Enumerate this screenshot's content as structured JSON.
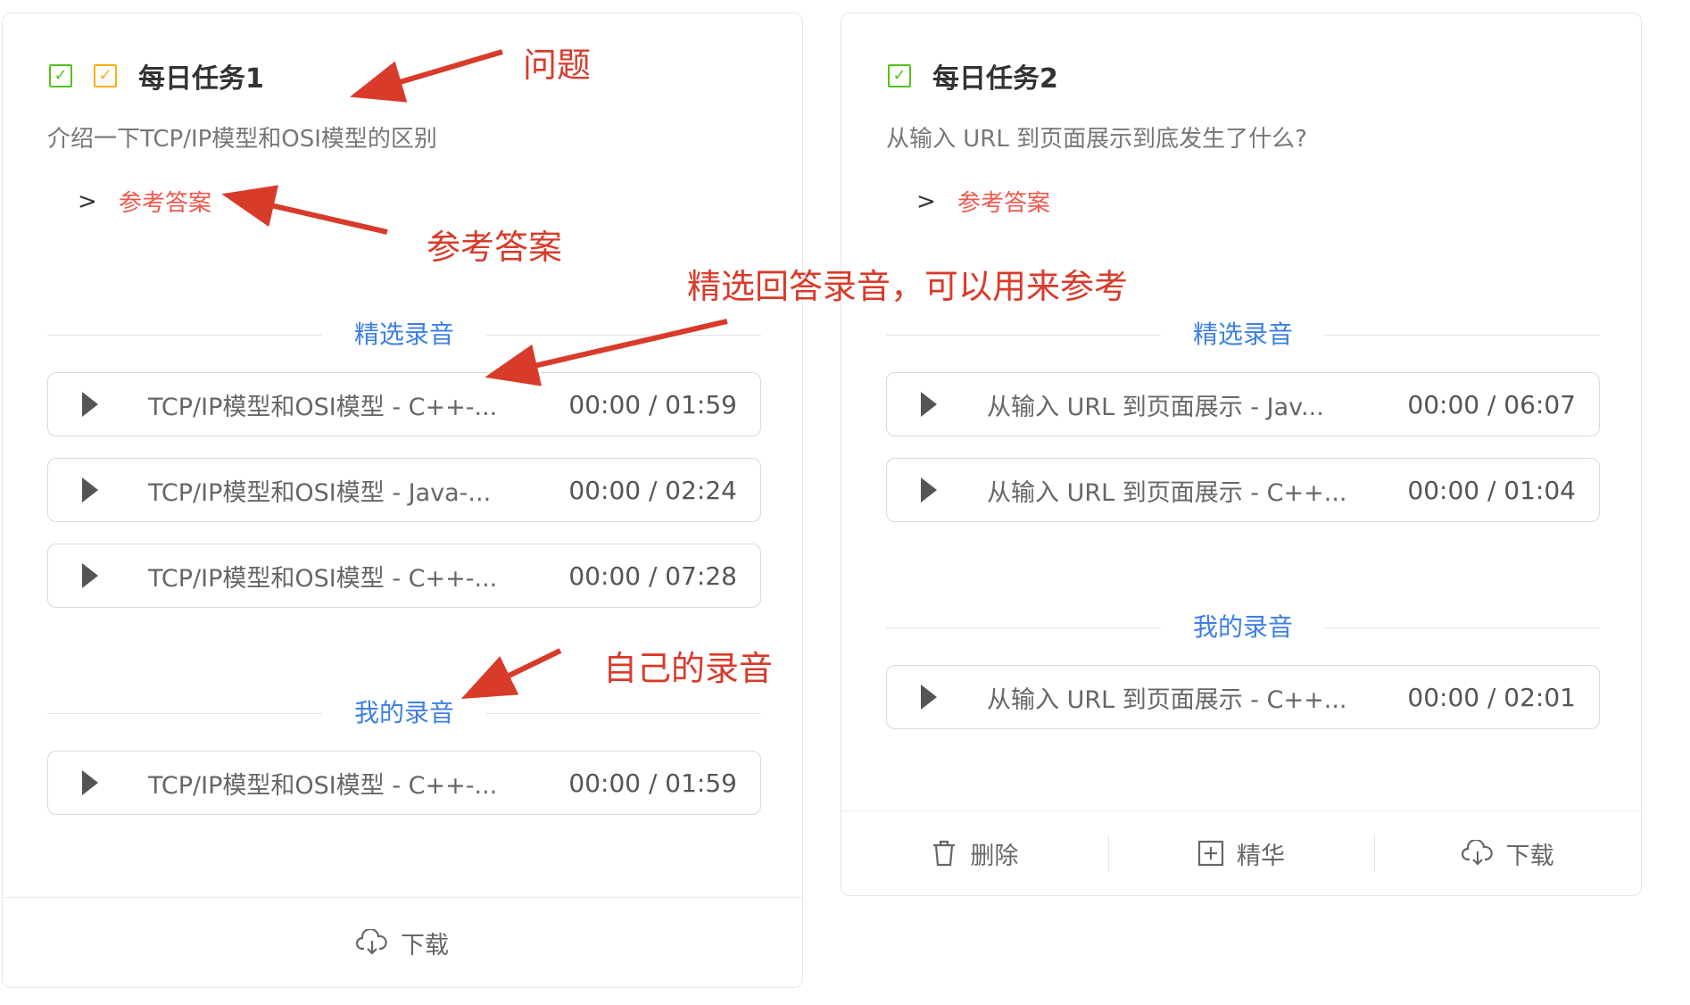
{
  "cards": [
    {
      "title": "每日任务1",
      "question": "介绍一下TCP/IP模型和OSI模型的区别",
      "answer_label": "参考答案",
      "featured_label": "精选录音",
      "featured_recordings": [
        {
          "name": "TCP/IP模型和OSI模型 - C++-...",
          "time": "00:00 / 01:59"
        },
        {
          "name": "TCP/IP模型和OSI模型 - Java-...",
          "time": "00:00 / 02:24"
        },
        {
          "name": "TCP/IP模型和OSI模型 - C++-...",
          "time": "00:00 / 07:28"
        }
      ],
      "mine_label": "我的录音",
      "my_recordings": [
        {
          "name": "TCP/IP模型和OSI模型 - C++-...",
          "time": "00:00 / 01:59"
        }
      ],
      "footer": {
        "download": "下载"
      }
    },
    {
      "title": "每日任务2",
      "question": "从输入 URL 到页面展示到底发生了什么?",
      "answer_label": "参考答案",
      "featured_label": "精选录音",
      "featured_recordings": [
        {
          "name": "从输入 URL 到页面展示 - Jav...",
          "time": "00:00 / 06:07"
        },
        {
          "name": "从输入 URL 到页面展示 - C++...",
          "time": "00:00 / 01:04"
        }
      ],
      "mine_label": "我的录音",
      "my_recordings": [
        {
          "name": "从输入 URL 到页面展示 - C++...",
          "time": "00:00 / 02:01"
        }
      ],
      "footer": {
        "delete": "删除",
        "highlight": "精华",
        "download": "下载"
      }
    }
  ],
  "annotations": {
    "question": "问题",
    "answer": "参考答案",
    "featured": "精选回答录音，可以用来参考",
    "mine": "自己的录音"
  },
  "colors": {
    "accent_blue": "#3d7fe6",
    "answer_red": "#f0564a",
    "annotation_red": "#d83b2a",
    "check_green": "#52c41a",
    "check_orange": "#faad14"
  }
}
